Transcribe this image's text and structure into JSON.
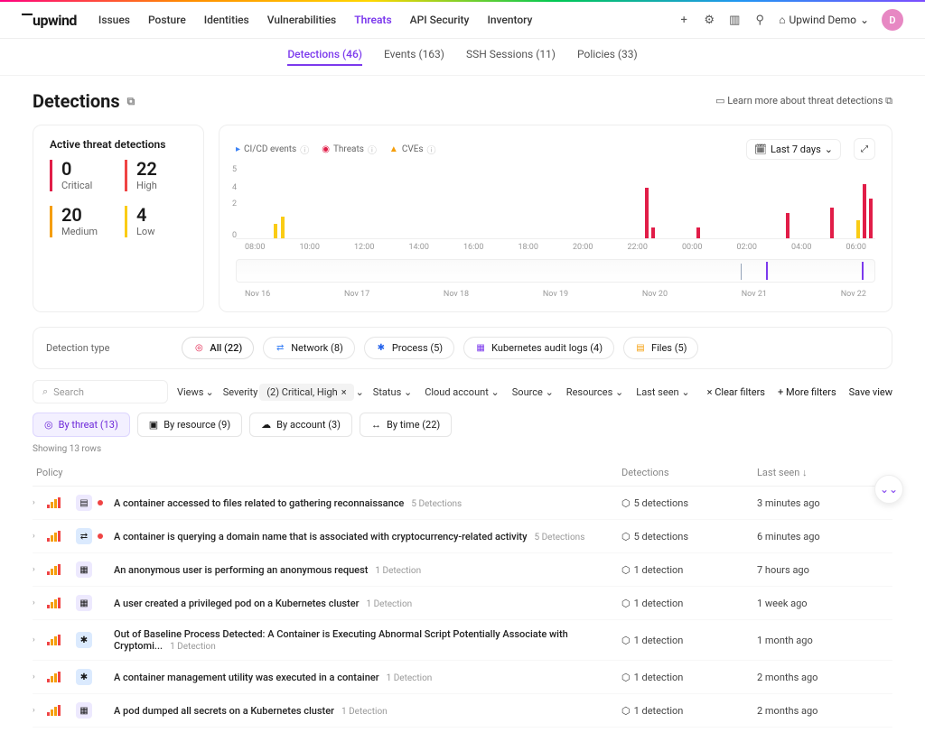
{
  "brand": "upwind",
  "nav": [
    "Issues",
    "Posture",
    "Identities",
    "Vulnerabilities",
    "Threats",
    "API Security",
    "Inventory"
  ],
  "nav_active": 4,
  "org": {
    "label": "Upwind Demo",
    "avatar": "D"
  },
  "subnav": [
    {
      "label": "Detections (46)",
      "active": true
    },
    {
      "label": "Events (163)",
      "active": false
    },
    {
      "label": "SSH Sessions (11)",
      "active": false
    },
    {
      "label": "Policies (33)",
      "active": false
    }
  ],
  "page_title": "Detections",
  "learn_more": "Learn more about threat detections",
  "summary": {
    "title": "Active threat detections",
    "critical": {
      "num": "0",
      "lbl": "Critical"
    },
    "high": {
      "num": "22",
      "lbl": "High"
    },
    "medium": {
      "num": "20",
      "lbl": "Medium"
    },
    "low": {
      "num": "4",
      "lbl": "Low"
    }
  },
  "chart_data": {
    "type": "bar",
    "series_legend": [
      "CI/CD events",
      "Threats",
      "CVEs"
    ],
    "time_range": "Last 7 days",
    "ylim": [
      0,
      5
    ],
    "hour_ticks": [
      "08:00",
      "10:00",
      "12:00",
      "14:00",
      "16:00",
      "18:00",
      "20:00",
      "22:00",
      "00:00",
      "02:00",
      "04:00",
      "06:00"
    ],
    "date_ticks": [
      "Nov 16",
      "Nov 17",
      "Nov 18",
      "Nov 19",
      "Nov 20",
      "Nov 21",
      "Nov 22"
    ],
    "bars": [
      {
        "x_pct": 6,
        "h": 16,
        "color": "#facc15"
      },
      {
        "x_pct": 7,
        "h": 24,
        "color": "#facc15"
      },
      {
        "x_pct": 64,
        "h": 56,
        "color": "#e11d48"
      },
      {
        "x_pct": 65,
        "h": 12,
        "color": "#e11d48"
      },
      {
        "x_pct": 72,
        "h": 12,
        "color": "#e11d48"
      },
      {
        "x_pct": 86,
        "h": 28,
        "color": "#e11d48"
      },
      {
        "x_pct": 93,
        "h": 34,
        "color": "#e11d48"
      },
      {
        "x_pct": 97,
        "h": 20,
        "color": "#facc15"
      },
      {
        "x_pct": 98,
        "h": 60,
        "color": "#e11d48"
      },
      {
        "x_pct": 99,
        "h": 44,
        "color": "#e11d48"
      }
    ]
  },
  "detection_types": {
    "label": "Detection type",
    "items": [
      {
        "icon": "◎",
        "label": "All (22)",
        "color": "#e11d48",
        "active": true
      },
      {
        "icon": "⇄",
        "label": "Network (8)",
        "color": "#3b82f6"
      },
      {
        "icon": "✱",
        "label": "Process (5)",
        "color": "#2563eb"
      },
      {
        "icon": "▦",
        "label": "Kubernetes audit logs (4)",
        "color": "#7c3aed"
      },
      {
        "icon": "▤",
        "label": "Files (5)",
        "color": "#f59e0b"
      }
    ]
  },
  "search_placeholder": "Search",
  "filters": {
    "views": "Views",
    "severity_label": "Severity",
    "severity_value": "(2) Critical, High",
    "dropdowns": [
      "Status",
      "Cloud account",
      "Source",
      "Resources",
      "Last seen"
    ],
    "clear": "Clear filters",
    "more": "More filters",
    "save": "Save view"
  },
  "groups": [
    {
      "icon": "◎",
      "label": "By threat (13)",
      "active": true
    },
    {
      "icon": "▣",
      "label": "By resource (9)"
    },
    {
      "icon": "☁",
      "label": "By account (3)"
    },
    {
      "icon": "↔",
      "label": "By time (22)"
    }
  ],
  "showing": "Showing 13 rows",
  "columns": {
    "policy": "Policy",
    "det": "Detections",
    "seen": "Last seen ↓"
  },
  "rows": [
    {
      "sev": "#ef4444",
      "icon": "▤",
      "iconbg": "#ede9fe",
      "name": "A container accessed to files related to gathering reconnaissance",
      "badge": "5 Detections",
      "det": "5 detections",
      "seen": "3 minutes ago"
    },
    {
      "sev": "#ef4444",
      "icon": "⇄",
      "iconbg": "#dbeafe",
      "name": "A container is querying a domain name that is associated with cryptocurrency-related activity",
      "badge": "5 Detections",
      "det": "5 detections",
      "seen": "6 minutes ago"
    },
    {
      "sev": "",
      "icon": "▦",
      "iconbg": "#ede9fe",
      "name": "An anonymous user is performing an anonymous request",
      "badge": "1 Detection",
      "det": "1 detection",
      "seen": "7 hours ago"
    },
    {
      "sev": "",
      "icon": "▦",
      "iconbg": "#ede9fe",
      "name": "A user created a privileged pod on a Kubernetes cluster",
      "badge": "1 Detection",
      "det": "1 detection",
      "seen": "1 week ago"
    },
    {
      "sev": "",
      "icon": "✱",
      "iconbg": "#dbeafe",
      "name": "Out of Baseline Process Detected: A Container is Executing Abnormal Script Potentially Associate with Cryptomi...",
      "badge": "1 Detection",
      "det": "1 detection",
      "seen": "1 month ago"
    },
    {
      "sev": "",
      "icon": "✱",
      "iconbg": "#dbeafe",
      "name": "A container management utility was executed in a container",
      "badge": "1 Detection",
      "det": "1 detection",
      "seen": "2 months ago"
    },
    {
      "sev": "",
      "icon": "▦",
      "iconbg": "#ede9fe",
      "name": "A pod dumped all secrets on a Kubernetes cluster",
      "badge": "1 Detection",
      "det": "1 detection",
      "seen": "2 months ago"
    }
  ]
}
